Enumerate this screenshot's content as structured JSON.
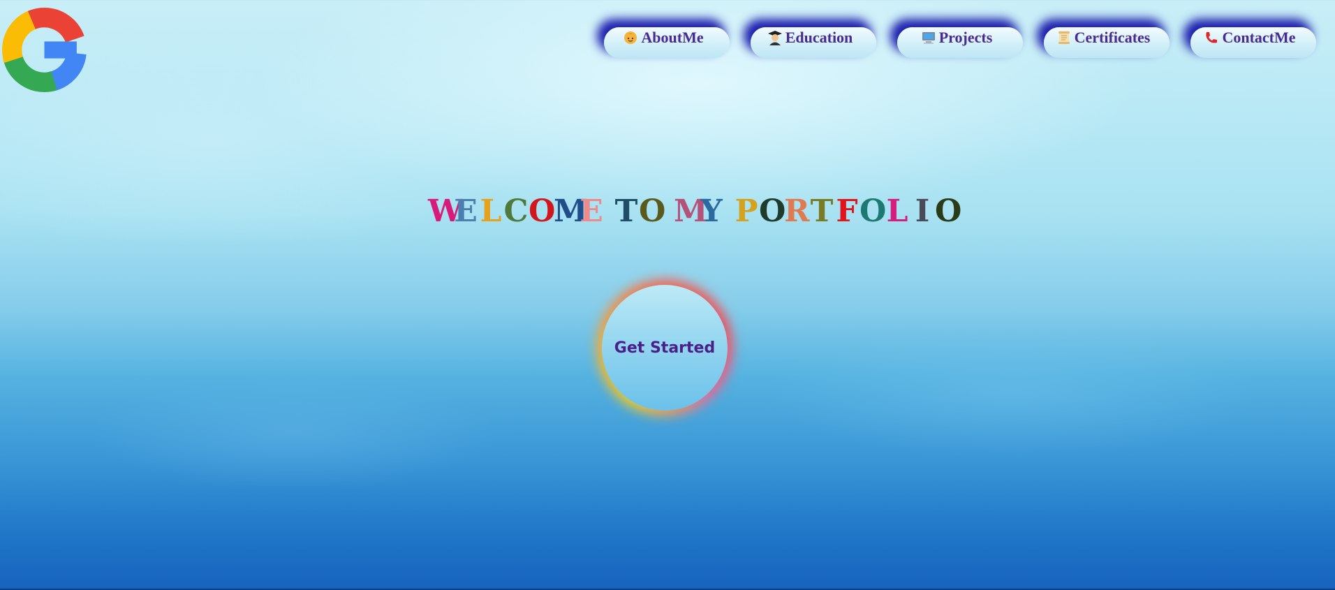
{
  "logo": {
    "icon": "google-g-icon"
  },
  "nav": {
    "items": [
      {
        "label": "AboutMe",
        "icon": "person-emoji-icon"
      },
      {
        "label": "Education",
        "icon": "graduate-emoji-icon"
      },
      {
        "label": "Projects",
        "icon": "computer-emoji-icon"
      },
      {
        "label": "Certificates",
        "icon": "scroll-emoji-icon"
      },
      {
        "label": "ContactMe",
        "icon": "telephone-emoji-icon"
      }
    ]
  },
  "hero": {
    "headline_words": [
      "WELCOME",
      "TO",
      "MY",
      "PORTFOLIO"
    ],
    "letter_colors": [
      "#d81b7a",
      "#4b7fb0",
      "#e6a21c",
      "#4f7a3b",
      "#d2161e",
      "#1f4e8a",
      "#f08a8a",
      "#1f4d68",
      "#5a5a1e",
      "#b5527a",
      "#2a6aa0",
      "#d5a21d",
      "#1f3b2b",
      "#e07a50",
      "#7b7a25",
      "#e0151b",
      "#1d7a72",
      "#d41d7e",
      "#4a4a5a",
      "#2a3b1a"
    ],
    "cta_label": "Get Started"
  },
  "colors": {
    "nav_text": "#4a2a92",
    "nav_shadow": "#1414aa",
    "cta_text": "#4b1f8a"
  }
}
